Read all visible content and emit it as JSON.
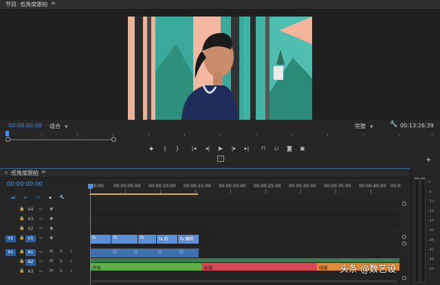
{
  "program_monitor": {
    "title": "节目: 低角度跟拍",
    "menu_icon": "≡",
    "timecode_current": "00:00:00:00",
    "fit": "适合",
    "quality": "完整",
    "timecode_duration": "00:13:26:39"
  },
  "timeline": {
    "title": "低角度跟拍",
    "menu_icon": "≡",
    "timecode": "00:00:00:00",
    "ruler_labels": [
      ":00:00",
      "00:00:05:00",
      "00:00:10:00",
      "00:00:15:00",
      "00:00:20:00",
      "00:00:25:00",
      "00:00:30:00",
      "00:00:35:00",
      "00:00:40:00",
      "00:0"
    ],
    "video_tracks": [
      {
        "name": "V4",
        "source": ""
      },
      {
        "name": "V3",
        "source": ""
      },
      {
        "name": "V2",
        "source": ""
      },
      {
        "name": "V1",
        "source": "V1"
      }
    ],
    "audio_tracks": [
      {
        "name": "A1",
        "source": "A1",
        "m": "M",
        "s": "S"
      },
      {
        "name": "A2",
        "source": "",
        "m": "M",
        "s": "S"
      },
      {
        "name": "A3",
        "source": "",
        "m": "M",
        "s": "S"
      }
    ],
    "video_clips": [
      {
        "label": "fx"
      },
      {
        "label": "fx"
      },
      {
        "label": "fx"
      },
      {
        "label": "fx 后"
      },
      {
        "label": "fx 跟拍"
      }
    ],
    "audio_clips": [
      {
        "label": "开始",
        "color": "#5fb04a"
      },
      {
        "label": "高潮",
        "color": "#d94a57"
      },
      {
        "label": "结尾",
        "color": "#e08a3c"
      }
    ]
  },
  "meters": {
    "db_labels": [
      "0",
      "-6",
      "-12",
      "-18",
      "-24",
      "-30",
      "-36",
      "-42",
      "-48",
      "-54"
    ]
  },
  "watermark": "头条 @数艺设"
}
